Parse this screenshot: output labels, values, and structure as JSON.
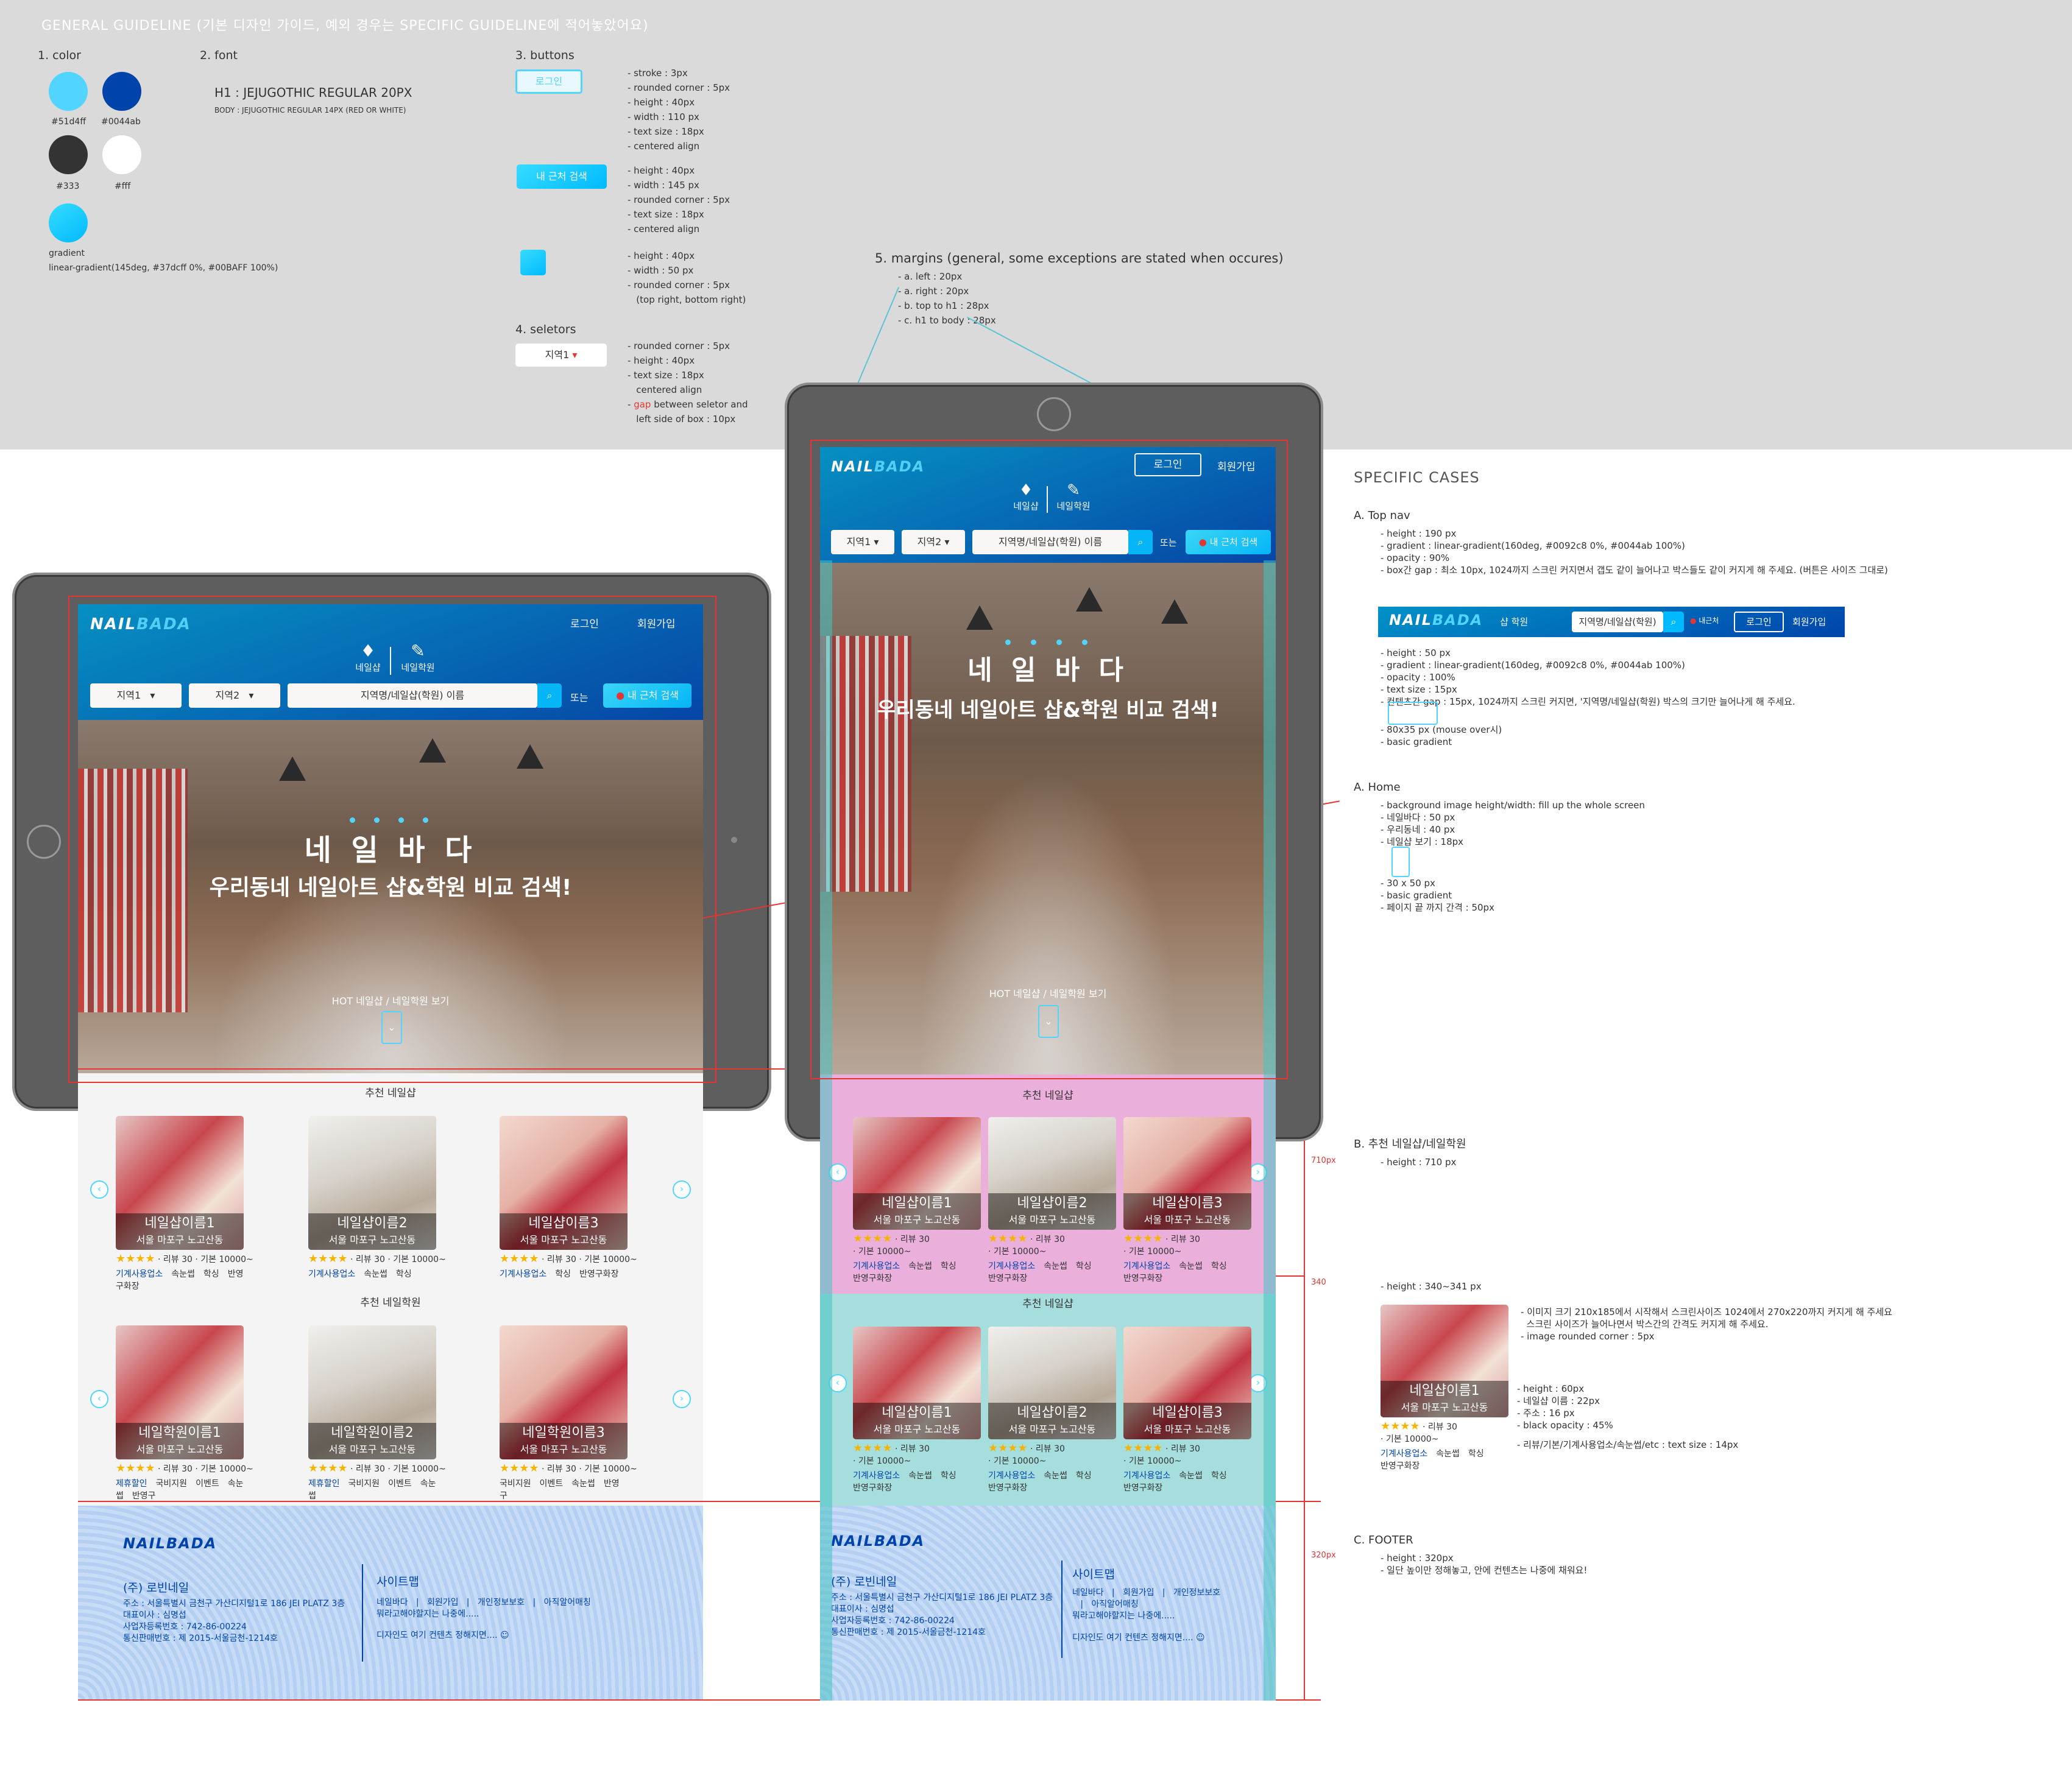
{
  "general": {
    "title_bold": "GENERAL GUIDELINE",
    "title_rest": " (기본 디자인 가이드, 예외 경우는 SPECIFIC GUIDELINE에 적어놓았어요)",
    "color": {
      "heading": "1. color",
      "swatches": [
        {
          "hex": "#51d4ff",
          "label": "#51d4ff"
        },
        {
          "hex": "#0044ab",
          "label": "#0044ab"
        },
        {
          "hex": "#333333",
          "label": "#333"
        },
        {
          "hex": "#ffffff",
          "label": "#fff"
        }
      ],
      "gradient_label": "gradient",
      "gradient_value": "linear-gradient(145deg, #37dcff 0%, #00BAFF 100%)"
    },
    "font": {
      "heading": "2. font",
      "h1": "H1 : JEJUGOTHIC REGULAR 20PX",
      "body": "BODY : JEJUGOTHIC REGULAR 14PX (RED OR WHITE)"
    },
    "buttons": {
      "heading": "3. buttons",
      "login_label": "로그인",
      "login_spec": "- stroke : 3px\n- rounded corner : 5px\n- height : 40px\n- width : 110 px\n- text size : 18px\n- centered align",
      "near_label": "내 근처 검색",
      "near_spec": "- height : 40px\n- width : 145 px\n- rounded corner : 5px\n- text size : 18px\n- centered align",
      "square_spec": "- height : 40px\n- width : 50 px\n- rounded corner : 5px\n   (top right, bottom right)"
    },
    "selectors": {
      "heading": "4. seletors",
      "label": "지역1",
      "spec_pre": "- rounded corner : 5px\n- height : 40px\n- text size : 18px\n   centered align\n- ",
      "spec_gap": "gap",
      "spec_post": " between seletor and\n   left side of box : 10px"
    },
    "margins": {
      "heading": "5. margins (general, some exceptions are stated when occures)",
      "items": "- a. left : 20px\n- a. right : 20px\n- b. top to h1 : 28px\n- c. h1 to body : 28px"
    }
  },
  "site": {
    "logo_a": "NAIL",
    "logo_b": "BADA",
    "login": "로그인",
    "signup": "회원가입",
    "tab_shop": "네일샵",
    "tab_academy": "네일학원",
    "region1": "지역1",
    "region2": "지역2",
    "search_placeholder": "지역명/네일샵(학원) 이름",
    "or": "또는",
    "near": "내 근처 검색",
    "hero_title": "네 일 바 다",
    "hero_sub": "우리동네 네일아트 샵&학원 비교 검색!",
    "hot": "HOT 네일샵 / 네일학원 보기",
    "rec_shop": "추천 네일샵",
    "rec_academy": "추천 네일학원",
    "shops": [
      {
        "name": "네일샵이름1",
        "addr": "서울 마포구 노고산동",
        "stars": "★★★★",
        "meta": "· 리뷰 30 · 기본 10000~",
        "tags": [
          "기계사용업소",
          "속눈썹",
          "학싱",
          "반영구화장"
        ]
      },
      {
        "name": "네일샵이름2",
        "addr": "서울 마포구 노고산동",
        "stars": "★★★★",
        "meta": "· 리뷰 30 · 기본 10000~",
        "tags": [
          "기계사용업소",
          "속눈썹",
          "학싱"
        ]
      },
      {
        "name": "네일샵이름3",
        "addr": "서울 마포구 노고산동",
        "stars": "★★★★",
        "meta": "· 리뷰 30 · 기본 10000~",
        "tags": [
          "기계사용업소",
          "학싱",
          "반영구화장"
        ]
      }
    ],
    "academies": [
      {
        "name": "네일학원이름1",
        "addr": "서울 마포구 노고산동",
        "stars": "★★★★",
        "meta": "· 리뷰 30 · 기본 10000~",
        "tags": [
          "제휴할인",
          "국비지원",
          "이벤트",
          "속눈썹",
          "반영구"
        ]
      },
      {
        "name": "네일학원이름2",
        "addr": "서울 마포구 노고산동",
        "stars": "★★★★",
        "meta": "· 리뷰 30 · 기본 10000~",
        "tags": [
          "제휴할인",
          "국비지원",
          "이벤트",
          "속눈썹"
        ]
      },
      {
        "name": "네일학원이름3",
        "addr": "서울 마포구 노고산동",
        "stars": "★★★★",
        "meta": "· 리뷰 30 · 기본 10000~",
        "tags": [
          "국비지원",
          "이벤트",
          "속눈썹",
          "반영구"
        ]
      }
    ],
    "portrait_shops": [
      {
        "name": "네일샵이름1",
        "addr": "서울 마포구 노고산동",
        "stars": "★★★★",
        "meta": "· 리뷰 30\n· 기본 10000~",
        "tags": [
          "기계사용업소",
          "속눈썹",
          "학싱",
          "반영구화장"
        ]
      },
      {
        "name": "네일샵이름2",
        "addr": "서울 마포구 노고산동",
        "stars": "★★★★",
        "meta": "· 리뷰 30\n· 기본 10000~",
        "tags": [
          "기계사용업소",
          "속눈썹",
          "학싱",
          "반영구화장"
        ]
      },
      {
        "name": "네일샵이름3",
        "addr": "서울 마포구 노고산동",
        "stars": "★★★★",
        "meta": "· 리뷰 30\n· 기본 10000~",
        "tags": [
          "기계사용업소",
          "속눈썹",
          "학싱",
          "반영구화장"
        ]
      }
    ],
    "footer": {
      "company": "(주) 로빈네일",
      "info": "주소 : 서울특별시 금천구 가산디지털1로 186 JEI PLATZ 3층\n대표이사 : 심명섭\n사업자등록번호 : 742-86-00224\n통신판매번호 : 제 2015-서울금천-1214호",
      "sitemap": "사이트맵",
      "links": "네일바다   |   회원가입   |   개인정보보호   |   아직알어매칭\n뭐라고해야할지는 나중에.....",
      "links_portrait": "네일바다   |   회원가입   |   개인정보보호\n   |   아직알어매칭\n뭐라고해야할지는 나중에.....",
      "design": "디자인도 여기 컨텐츠 정해지면.... ☺"
    }
  },
  "specific": {
    "heading": "SPECIFIC CASES",
    "topnav_h": "A. Top nav",
    "topnav_spec": "- height : 190 px\n- gradient : linear-gradient(160deg, #0092c8 0%, #0044ab 100%)\n- opacity : 90%\n- box간 gap : 최소 10px, 1024까지 스크린 커지면서 갭도 같이 늘어나고 박스들도 같이 커지게 해 주세요. (버튼은 사이즈 그대로)",
    "compact_tabs": "샵   학원",
    "compact_search": "지역명/네일샵(학원)",
    "compact_near": "내근처",
    "compact_spec": "- height : 50 px\n- gradient : linear-gradient(160deg, #0092c8 0%, #0044ab 100%)\n- opacity : 100%\n- text size : 15px\n- 컨텐츠간 gap : 15px, 1024까지 스크린 커지면, '지역명/네일샵(학원) 박스의 크기만 늘어나게 해 주세요.",
    "compact_spec2": "- 80x35 px (mouse over시)\n- basic gradient",
    "home_h": "A. Home",
    "home_spec": "- background image height/width: fill up the whole screen\n- 네일바다 : 50 px\n- 우리동네 : 40 px\n- 네일샵 보기 : 18px",
    "home_spec2": "- 30 x 50 px\n- basic gradient\n- 페이지 끝 까지 간격 : 50px",
    "rec_h": "B. 추천 네일샵/네일학원",
    "rec_710": "710px",
    "rec_spec": "- height : 710 px",
    "rec_340": "340",
    "rec_spec2": "- height : 340~341 px",
    "card_spec": "- 이미지 크기 210x185에서 시작해서 스크린사이즈 1024에서 270x220까지 커지게 해 주세요\n  스크린 사이즈가 늘어나면서 박스간의 간격도 커지게 해 주세요.\n- image rounded corner : 5px",
    "card_spec2": "- height : 60px\n- 네일샵 이름 : 22px\n- 주소 : 16 px\n- black opacity : 45%",
    "card_spec3": "- 리뷰/기본/기계사용업소/속눈썹/etc : text size : 14px",
    "footer_h": "C. FOOTER",
    "footer_320": "320px",
    "footer_spec": "- height : 320px\n- 일단 높이만 정해놓고, 안에 컨텐츠는 나중에 채워요!"
  },
  "colors": {
    "accent": "#51d4ff",
    "brand": "#0044ab",
    "text": "#333333",
    "red": "#e63434"
  }
}
